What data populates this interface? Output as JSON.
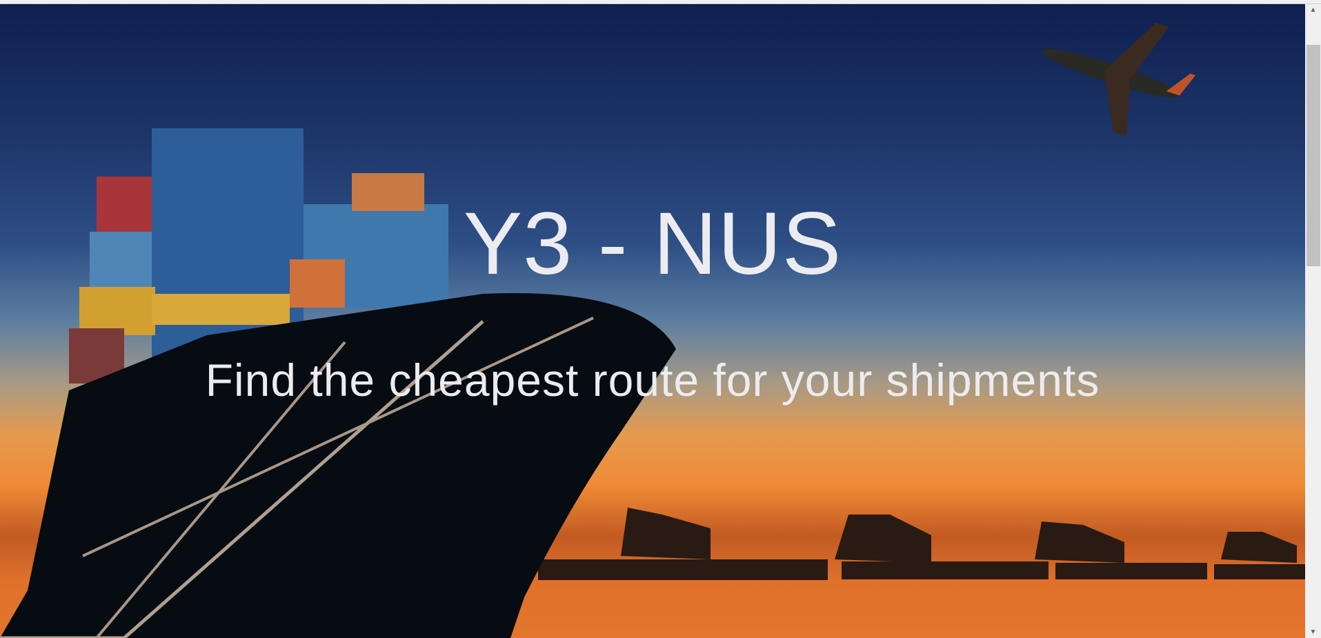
{
  "hero": {
    "title": "Y3 - NUS",
    "subtitle": "Find the cheapest route for your shipments"
  },
  "scrollbar": {
    "up_arrow": "▲",
    "down_arrow": "▼",
    "position_fraction": 0.0
  }
}
